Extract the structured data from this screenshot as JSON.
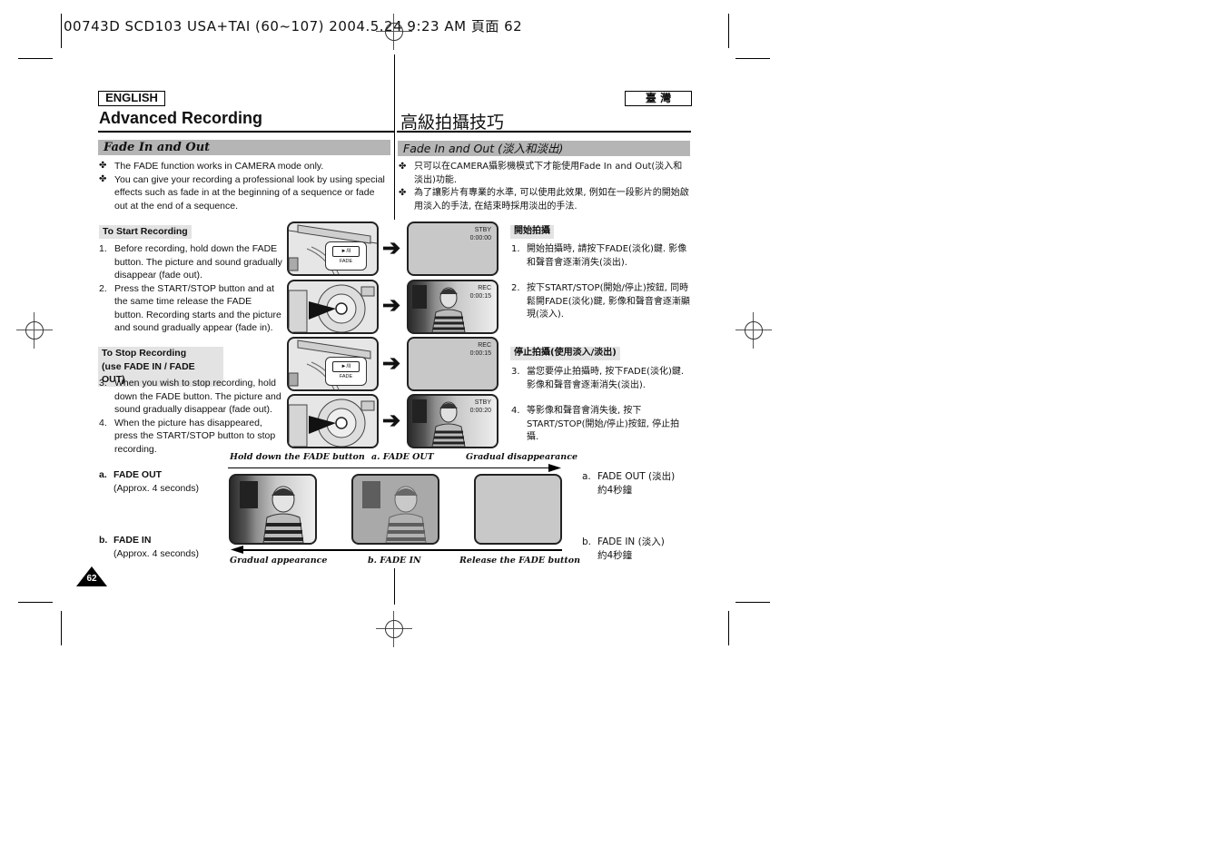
{
  "print_header": "00743D SCD103 USA+TAI (60~107)  2004.5.24  9:23 AM  頁面 62",
  "left": {
    "lang_label": "ENGLISH",
    "title": "Advanced Recording",
    "section": "Fade In and Out",
    "bullets": [
      "The FADE function works in CAMERA mode only.",
      "You can give your recording a professional look by using special effects such as fade in at the beginning of a sequence or fade out at the end of a sequence."
    ],
    "bullet_marker": "✤",
    "start": {
      "heading": "To Start Recording",
      "steps": [
        {
          "n": "1.",
          "text": "Before recording, hold down the FADE button. The picture and sound gradually disappear (fade out)."
        },
        {
          "n": "2.",
          "text": "Press the START/STOP button and at the same time release the FADE button. Recording starts and the picture and sound gradually appear (fade in)."
        }
      ]
    },
    "stop": {
      "heading_line1": "To Stop Recording",
      "heading_line2": "(use FADE IN / FADE OUT)",
      "steps": [
        {
          "n": "3.",
          "text": "When you wish to stop recording, hold down the FADE button. The picture and sound gradually disappear (fade out)."
        },
        {
          "n": "4.",
          "text": "When the picture has disappeared, press the START/STOP button to stop recording."
        }
      ]
    },
    "ab": [
      {
        "label": "a.",
        "title": "FADE OUT",
        "sub": "(Approx. 4 seconds)"
      },
      {
        "label": "b.",
        "title": "FADE IN",
        "sub": "(Approx. 4 seconds)"
      }
    ],
    "page_number": "62"
  },
  "right": {
    "lang_label": "臺  灣",
    "title": "高級拍攝技巧",
    "section": "Fade In and Out (淡入和淡出)",
    "bullets": [
      "只可以在CAMERA攝影機模式下才能使用Fade In and Out(淡入和淡出)功能.",
      "為了讓影片有專業的水準, 可以使用此效果, 例如在一段影片的開始啟用淡入的手法, 在結束時採用淡出的手法."
    ],
    "start": {
      "heading": "開始拍攝",
      "steps": [
        {
          "n": "1.",
          "text": "開始拍攝時, 請按下FADE(淡化)鍵. 影像和聲音會逐漸消失(淡出)."
        },
        {
          "n": "2.",
          "text": "按下START/STOP(開始/停止)按鈕, 同時鬆開FADE(淡化)鍵, 影像和聲音會逐漸顯現(淡入)."
        }
      ]
    },
    "stop": {
      "heading": "停止拍攝(使用淡入/淡出)",
      "steps": [
        {
          "n": "3.",
          "text": "當您要停止拍攝時, 按下FADE(淡化)鍵. 影像和聲音會逐漸消失(淡出)."
        },
        {
          "n": "4.",
          "text": "等影像和聲音會消失後, 按下START/STOP(開始/停止)按鈕, 停止拍攝."
        }
      ]
    },
    "ab": [
      {
        "label": "a.",
        "title": "FADE OUT (淡出)",
        "sub": "約4秒鐘"
      },
      {
        "label": "b.",
        "title": "FADE IN (淡入)",
        "sub": "約4秒鐘"
      }
    ]
  },
  "figures": {
    "button_label": "►/II",
    "fade_label": "FADE",
    "arrow": "➔",
    "lcd": [
      {
        "mode": "STBY",
        "time": "0:00:00"
      },
      {
        "mode": "REC",
        "time": "0:00:15"
      },
      {
        "mode": "REC",
        "time": "0:00:15"
      },
      {
        "mode": "STBY",
        "time": "0:00:20"
      }
    ]
  },
  "timeline": {
    "top_left": "Hold down the FADE button",
    "top_mid": "a. FADE OUT",
    "top_right": "Gradual disappearance",
    "bottom_left": "Gradual appearance",
    "bottom_mid": "b. FADE IN",
    "bottom_right": "Release the FADE button"
  }
}
